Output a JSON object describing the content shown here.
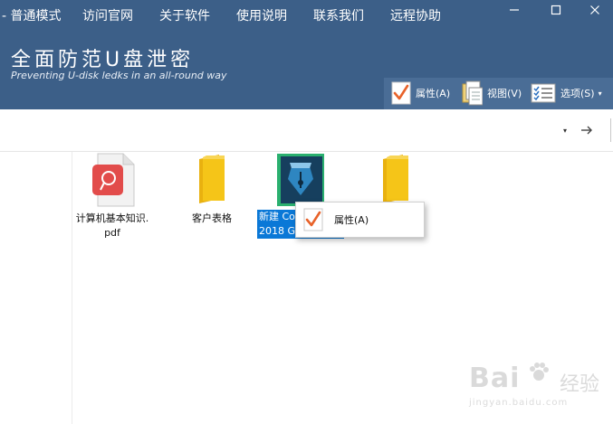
{
  "menu": {
    "items": [
      {
        "label": "- 普通模式"
      },
      {
        "label": "访问官网"
      },
      {
        "label": "关于软件"
      },
      {
        "label": "使用说明"
      },
      {
        "label": "联系我们"
      },
      {
        "label": "远程协助"
      }
    ]
  },
  "window_controls": [
    "minimize-icon",
    "maximize-icon",
    "close-icon"
  ],
  "app": {
    "title": "全面防范U盘泄密",
    "subtitle": "Preventing U-disk ledks in an all-round way"
  },
  "toolbar": {
    "properties_label": "属性(A)",
    "view_label": "视图(V)",
    "options_label": "选项(S)"
  },
  "nav": {
    "dropdown_glyph": "▾"
  },
  "files": [
    {
      "name_line1": "计算机基本知识.",
      "name_line2": "pdf",
      "icon": "pdf-file-icon",
      "selected": false
    },
    {
      "name_line1": "客户表格",
      "name_line2": "",
      "icon": "folder-icon",
      "selected": false
    },
    {
      "name_line1": "新建 Co",
      "name_line2": "2018 G",
      "icon": "coreldraw-file-icon",
      "selected": true
    },
    {
      "name_line1": "",
      "name_line2": "",
      "icon": "folder-icon",
      "selected": false
    }
  ],
  "context_menu": {
    "items": [
      {
        "label": "属性(A)",
        "icon": "checkmark-icon"
      }
    ]
  },
  "watermark": {
    "main": "Bai",
    "cn": "经验",
    "sub": "jingyan.baidu.com"
  },
  "colors": {
    "header": "#3c5f88",
    "toolbar": "#4a6d96",
    "selection": "#0a78d7",
    "check": "#e8622a",
    "folder": "#f5c518"
  }
}
